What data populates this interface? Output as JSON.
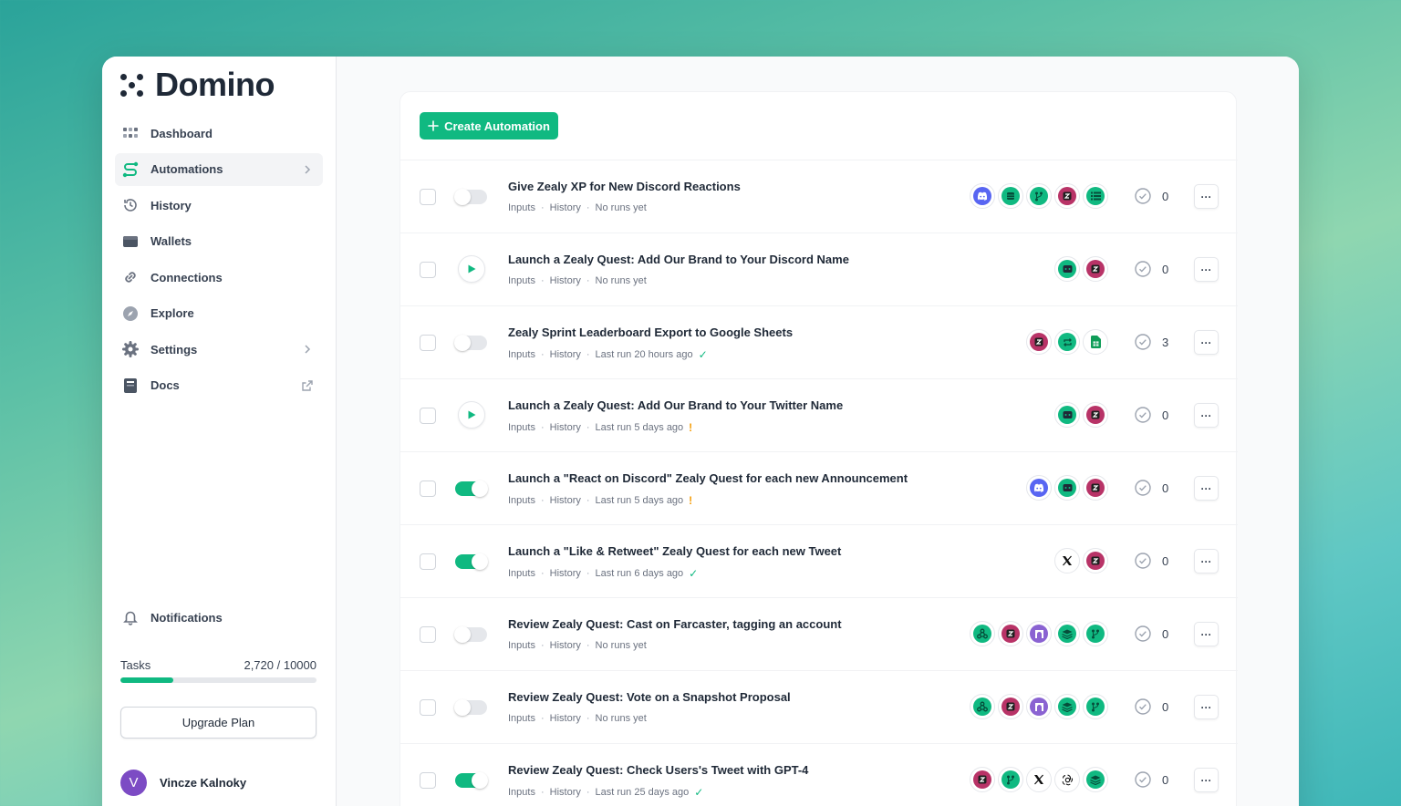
{
  "app": {
    "name": "Domino"
  },
  "sidebar": {
    "items": [
      {
        "label": "Dashboard"
      },
      {
        "label": "Automations"
      },
      {
        "label": "History"
      },
      {
        "label": "Wallets"
      },
      {
        "label": "Connections"
      },
      {
        "label": "Explore"
      },
      {
        "label": "Settings"
      },
      {
        "label": "Docs"
      }
    ],
    "notifications_label": "Notifications",
    "tasks": {
      "label": "Tasks",
      "count": "2,720 / 10000",
      "used": 2720,
      "limit": 10000
    },
    "upgrade_label": "Upgrade Plan",
    "user": {
      "initial": "V",
      "name": "Vincze Kalnoky"
    }
  },
  "colors": {
    "accent": "#10b981",
    "discord": "#5865f2",
    "zealy": "#b83367",
    "avatar": "#7c4bc4"
  },
  "main": {
    "create_label": "Create Automation",
    "meta_inputs": "Inputs",
    "meta_history": "History",
    "automations": [
      {
        "title": "Give Zealy XP for New Discord Reactions",
        "status": "No runs yet",
        "status_icon": "",
        "runs": "0",
        "control": "toggle-off",
        "icons": [
          "discord",
          "sheets-db",
          "branch",
          "zealy",
          "list"
        ]
      },
      {
        "title": "Launch a Zealy Quest: Add Our Brand to Your Discord Name",
        "status": "No runs yet",
        "status_icon": "",
        "runs": "0",
        "control": "play",
        "icons": [
          "bot",
          "zealy"
        ]
      },
      {
        "title": "Zealy Sprint Leaderboard Export to Google Sheets",
        "status": "Last run 20 hours ago",
        "status_icon": "check",
        "runs": "3",
        "control": "toggle-off",
        "icons": [
          "zealy",
          "repeat",
          "google-sheets"
        ]
      },
      {
        "title": "Launch a Zealy Quest: Add Our Brand to Your Twitter Name",
        "status": "Last run 5 days ago",
        "status_icon": "warn",
        "runs": "0",
        "control": "play",
        "icons": [
          "bot",
          "zealy"
        ]
      },
      {
        "title": "Launch a \"React on Discord\" Zealy Quest for each new Announcement",
        "status": "Last run 5 days ago",
        "status_icon": "warn",
        "runs": "0",
        "control": "toggle-on",
        "icons": [
          "discord",
          "bot",
          "zealy"
        ]
      },
      {
        "title": "Launch a \"Like & Retweet\" Zealy Quest for each new Tweet",
        "status": "Last run 6 days ago",
        "status_icon": "check",
        "runs": "0",
        "control": "toggle-on",
        "icons": [
          "x",
          "zealy"
        ]
      },
      {
        "title": "Review Zealy Quest: Cast on Farcaster, tagging an account",
        "status": "No runs yet",
        "status_icon": "",
        "runs": "0",
        "control": "toggle-off",
        "icons": [
          "webhook",
          "zealy",
          "farcaster",
          "stack",
          "branch"
        ]
      },
      {
        "title": "Review Zealy Quest: Vote on a Snapshot Proposal",
        "status": "No runs yet",
        "status_icon": "",
        "runs": "0",
        "control": "toggle-off",
        "icons": [
          "webhook",
          "zealy",
          "farcaster",
          "stack",
          "branch"
        ]
      },
      {
        "title": "Review Zealy Quest: Check Users's Tweet with GPT-4",
        "status": "Last run 25 days ago",
        "status_icon": "check",
        "runs": "0",
        "control": "toggle-on",
        "icons": [
          "zealy",
          "branch",
          "x",
          "openai",
          "stack"
        ]
      }
    ]
  }
}
